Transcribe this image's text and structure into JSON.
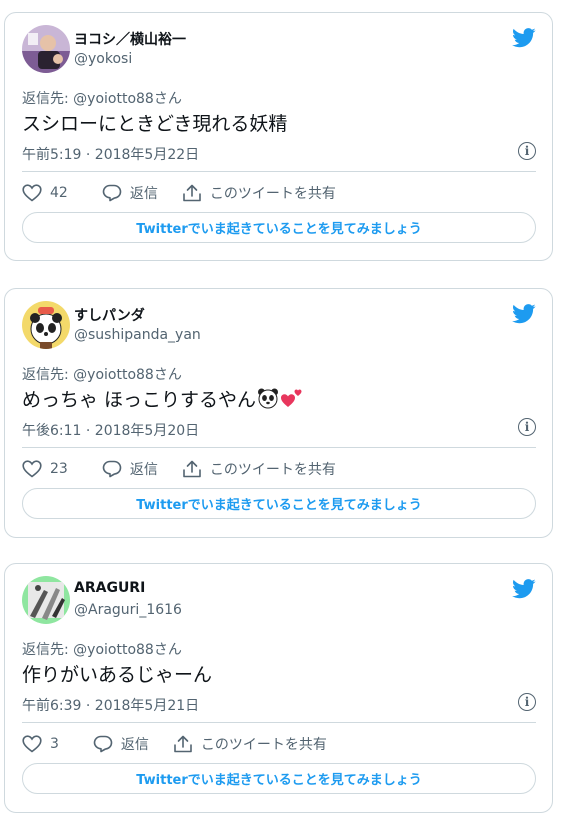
{
  "tweets": [
    {
      "name": "ヨコシ／横山裕一",
      "handle": "@yokosi",
      "reply_to": "返信先: @yoiotto88さん",
      "text": "スシローにときどき現れる妖精",
      "emoji": [],
      "timestamp": "午前5:19 · 2018年5月22日",
      "likes": "42",
      "reply_label": "返信",
      "share_label": "このツイートを共有",
      "cta_label": "Twitterでいま起きていることを見てみましょう"
    },
    {
      "name": "すしパンダ",
      "handle": "@sushipanda_yan",
      "reply_to": "返信先: @yoiotto88さん",
      "text": "めっちゃ ほっこりするやん",
      "emoji": [
        "panda-face-emoji",
        "heart-emoji"
      ],
      "timestamp": "午後6:11 · 2018年5月20日",
      "likes": "23",
      "reply_label": "返信",
      "share_label": "このツイートを共有",
      "cta_label": "Twitterでいま起きていることを見てみましょう"
    },
    {
      "name": "ARAGURI",
      "handle": "@Araguri_1616",
      "reply_to": "返信先: @yoiotto88さん",
      "text": "作りがいあるじゃーん",
      "emoji": [],
      "timestamp": "午前6:39 · 2018年5月21日",
      "likes": "3",
      "reply_label": "返信",
      "share_label": "このツイートを共有",
      "cta_label": "Twitterでいま起きていることを見てみましょう"
    }
  ],
  "icons": [
    "twitter-bird-icon",
    "info-icon",
    "heart-icon",
    "reply-icon",
    "share-icon"
  ],
  "colors": {
    "accent": "#1d9bf0",
    "text": "#0f1419",
    "secondary": "#536471",
    "border": "#cfd9de"
  }
}
